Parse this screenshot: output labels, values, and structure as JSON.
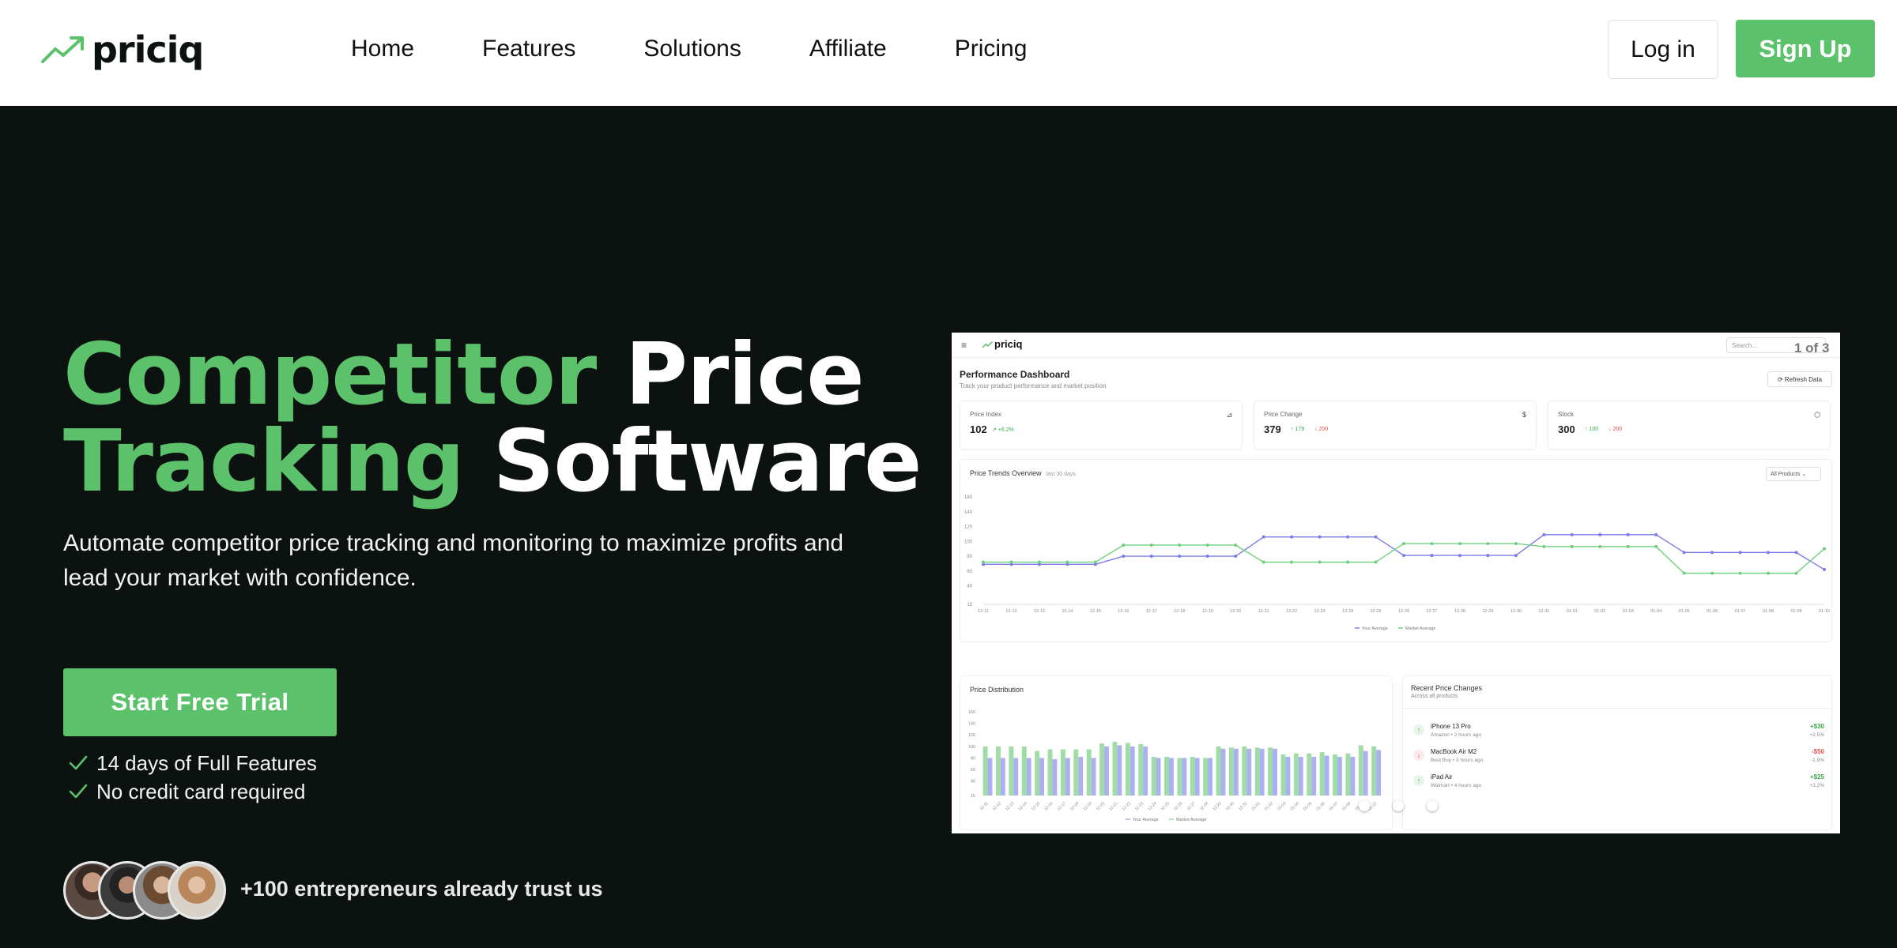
{
  "nav": {
    "brand": "priciq",
    "links": [
      "Home",
      "Features",
      "Solutions",
      "Affiliate",
      "Pricing"
    ],
    "login": "Log in",
    "signup": "Sign Up"
  },
  "hero": {
    "title_line1_green": "Competitor",
    "title_line1_white": "Price",
    "title_line2_green": "Tracking",
    "title_line2_white": "Software",
    "subtitle": "Automate competitor price tracking and monitoring to maximize profits and lead your market with confidence.",
    "cta": "Start Free Trial",
    "checks": [
      "14 days of Full Features",
      "No credit card required"
    ],
    "trust": "+100 entrepreneurs already trust us"
  },
  "colors": {
    "accent": "#5cc16b",
    "background": "#0b1210",
    "series_blue": "#7b7bea",
    "series_green": "#6fd07c"
  },
  "dashboard": {
    "brand": "priciq",
    "search_placeholder": "Search...",
    "counter": "1 of 3",
    "title": "Performance Dashboard",
    "subtitle": "Track your product performance and market position",
    "refresh": "Refresh Data",
    "cards": [
      {
        "label": "Price Index",
        "value": "102",
        "up": "↗ +6.2%",
        "down": "",
        "icon": "chart-icon"
      },
      {
        "label": "Price Change",
        "value": "379",
        "up": "↑ 179",
        "down": "↓ 200",
        "icon": "dollar-icon"
      },
      {
        "label": "Stock",
        "value": "300",
        "up": "↑ 100",
        "down": "↓ 200",
        "icon": "box-icon"
      }
    ],
    "trends_title": "Price Trends Overview",
    "trends_note": "last 30 days",
    "trends_select": "All Products",
    "distribution_title": "Price Distribution",
    "recent_title": "Recent Price Changes",
    "recent_sub": "Across all products",
    "recent": [
      {
        "name": "iPhone 13 Pro",
        "meta": "Amazon • 2 hours ago",
        "amount": "+$30",
        "pct": "+2.5%",
        "dir": "up"
      },
      {
        "name": "MacBook Air M2",
        "meta": "Best Buy • 3 hours ago",
        "amount": "-$50",
        "pct": "-1.8%",
        "dir": "down"
      },
      {
        "name": "iPad Air",
        "meta": "Walmart • 4 hours ago",
        "amount": "+$25",
        "pct": "+3.2%",
        "dir": "up"
      }
    ]
  },
  "chart_data": [
    {
      "type": "line",
      "title": "Price Trends Overview",
      "x": [
        "12-11",
        "12-12",
        "12-13",
        "12-14",
        "12-15",
        "12-16",
        "12-17",
        "12-18",
        "12-19",
        "12-20",
        "12-21",
        "12-22",
        "12-23",
        "12-24",
        "12-25",
        "12-26",
        "12-27",
        "12-28",
        "12-29",
        "12-30",
        "12-31",
        "01-01",
        "01-02",
        "01-03",
        "01-04",
        "01-05",
        "01-06",
        "01-07",
        "01-08",
        "01-09",
        "01-10"
      ],
      "yticks": [
        160,
        140,
        120,
        100,
        80,
        60,
        40,
        15
      ],
      "ylim": [
        15,
        160
      ],
      "series": [
        {
          "name": "Your Average",
          "color": "#7b7bea",
          "values": [
            69,
            69,
            69,
            69,
            69,
            80,
            80,
            80,
            80,
            80,
            106,
            106,
            106,
            106,
            106,
            81,
            81,
            81,
            81,
            81,
            109,
            109,
            109,
            109,
            109,
            85,
            85,
            85,
            85,
            85,
            62
          ]
        },
        {
          "name": "Market Average",
          "color": "#6fd07c",
          "values": [
            72,
            72,
            72,
            72,
            72,
            95,
            95,
            95,
            95,
            95,
            72,
            72,
            72,
            72,
            72,
            97,
            97,
            97,
            97,
            97,
            93,
            93,
            93,
            93,
            93,
            57,
            57,
            57,
            57,
            57,
            90
          ]
        }
      ],
      "legend": "bottom"
    },
    {
      "type": "bar",
      "title": "Price Distribution",
      "categories": [
        "12-11",
        "12-12",
        "12-13",
        "12-14",
        "12-15",
        "12-16",
        "12-17",
        "12-18",
        "12-19",
        "12-20",
        "12-21",
        "12-22",
        "12-23",
        "12-24",
        "12-25",
        "12-26",
        "12-27",
        "12-28",
        "12-29",
        "12-30",
        "12-31",
        "01-01",
        "01-02",
        "01-03",
        "01-04",
        "01-05",
        "01-06",
        "01-07",
        "01-08",
        "01-09",
        "01-10"
      ],
      "yticks": [
        160,
        140,
        120,
        100,
        80,
        60,
        40,
        15
      ],
      "ylim": [
        15,
        160
      ],
      "series": [
        {
          "name": "Market Average",
          "color": "#9fdca6",
          "values": [
            100,
            100,
            100,
            100,
            92,
            95,
            95,
            95,
            95,
            105,
            108,
            106,
            104,
            82,
            82,
            80,
            82,
            80,
            100,
            98,
            100,
            98,
            98,
            86,
            88,
            88,
            90,
            86,
            88,
            102,
            100
          ]
        },
        {
          "name": "Your Average",
          "color": "#aab0f0",
          "values": [
            80,
            80,
            80,
            80,
            80,
            78,
            80,
            82,
            80,
            100,
            102,
            100,
            100,
            80,
            80,
            80,
            80,
            80,
            96,
            96,
            96,
            96,
            96,
            82,
            82,
            82,
            84,
            82,
            82,
            92,
            94
          ]
        }
      ],
      "legend": "bottom"
    }
  ]
}
